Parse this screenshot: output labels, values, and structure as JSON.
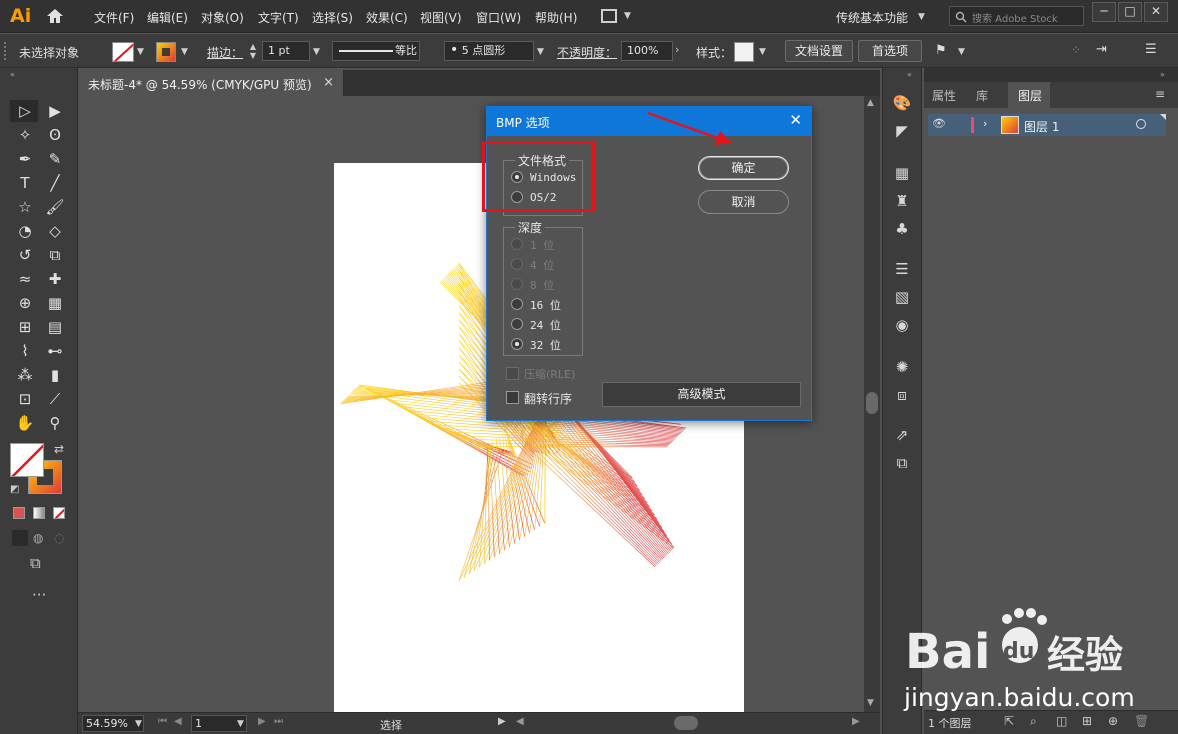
{
  "app": {
    "logo": "Ai",
    "menu": [
      "文件(F)",
      "编辑(E)",
      "对象(O)",
      "文字(T)",
      "选择(S)",
      "效果(C)",
      "视图(V)",
      "窗口(W)",
      "帮助(H)"
    ],
    "workspace": "传统基本功能",
    "stock_search": "搜索 Adobe Stock"
  },
  "control_bar": {
    "selection_state": "未选择对象",
    "stroke_label": "描边：",
    "stroke_weight": "1 pt",
    "stroke_profile": "等比",
    "brush": "5 点圆形",
    "opacity_label": "不透明度：",
    "opacity": "100%",
    "style_label": "样式：",
    "doc_setup": "文档设置",
    "preferences": "首选项"
  },
  "document_tab": {
    "title": "未标题-4* @ 54.59% (CMYK/GPU 预览)",
    "close": "×"
  },
  "status_bar": {
    "zoom": "54.59%",
    "artboard": "1",
    "tool": "选择"
  },
  "layers_panel": {
    "tabs": [
      "属性",
      "库",
      "图层"
    ],
    "active_tab": "图层",
    "layer_name": "图层 1",
    "footer": "1 个图层"
  },
  "dialog": {
    "title": "BMP 选项",
    "format_group": "文件格式",
    "formats": [
      {
        "label": "Windows",
        "selected": true
      },
      {
        "label": "OS/2",
        "selected": false
      }
    ],
    "depth_group": "深度",
    "depths": [
      {
        "label": "1 位",
        "selected": false,
        "disabled": true
      },
      {
        "label": "4 位",
        "selected": false,
        "disabled": true
      },
      {
        "label": "8 位",
        "selected": false,
        "disabled": true
      },
      {
        "label": "16 位",
        "selected": false,
        "disabled": false
      },
      {
        "label": "24 位",
        "selected": false,
        "disabled": false
      },
      {
        "label": "32 位",
        "selected": true,
        "disabled": false
      }
    ],
    "compress": "压缩(RLE)",
    "flip": "翻转行序",
    "advanced": "高级模式",
    "ok": "确定",
    "cancel": "取消"
  },
  "watermark": {
    "brand": "Bai du 经验",
    "url": "jingyan.baidu.com"
  },
  "colors": {
    "accent_blue": "#0f77d9",
    "highlight_red": "#e0151b",
    "gradient_start": "#ffd200",
    "gradient_end": "#e03a3a"
  }
}
